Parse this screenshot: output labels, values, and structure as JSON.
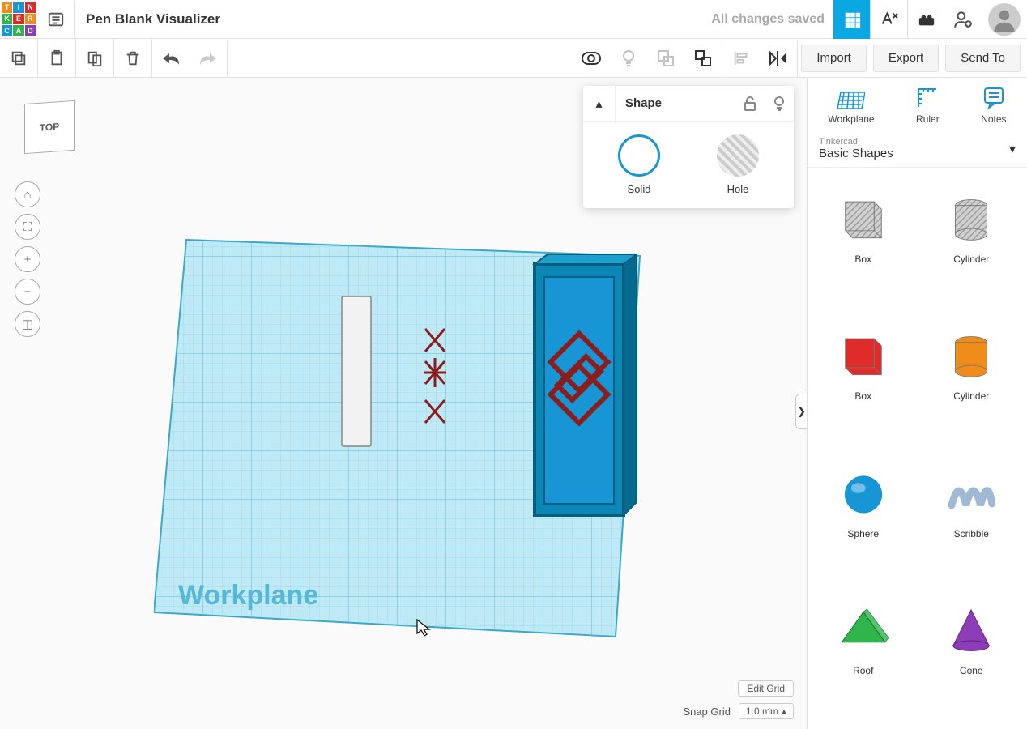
{
  "header": {
    "title": "Pen Blank Visualizer",
    "save_status": "All changes saved"
  },
  "toolbar_actions": {
    "import": "Import",
    "export": "Export",
    "send_to": "Send To"
  },
  "rp_tools": {
    "workplane": "Workplane",
    "ruler": "Ruler",
    "notes": "Notes"
  },
  "library_dropdown": {
    "source": "Tinkercad",
    "category": "Basic Shapes"
  },
  "shapes": [
    {
      "name": "Box",
      "color": "#bdbdbd",
      "striped": true,
      "type": "box"
    },
    {
      "name": "Cylinder",
      "color": "#bdbdbd",
      "striped": true,
      "type": "cyl"
    },
    {
      "name": "Box",
      "color": "#e02b2b",
      "type": "box"
    },
    {
      "name": "Cylinder",
      "color": "#f08c1a",
      "type": "cyl"
    },
    {
      "name": "Sphere",
      "color": "#1795d4",
      "type": "sphere"
    },
    {
      "name": "Scribble",
      "color": "#9fb8d4",
      "type": "scrib"
    },
    {
      "name": "Roof",
      "color": "#2fb54c",
      "type": "roof"
    },
    {
      "name": "Cone",
      "color": "#8e3db8",
      "type": "cone"
    }
  ],
  "inspector": {
    "title": "Shape",
    "mode_solid": "Solid",
    "mode_hole": "Hole"
  },
  "viewcube": "TOP",
  "workplane_label": "Workplane",
  "bottom": {
    "edit_grid": "Edit Grid",
    "snap_label": "Snap Grid",
    "snap_value": "1.0 mm"
  }
}
